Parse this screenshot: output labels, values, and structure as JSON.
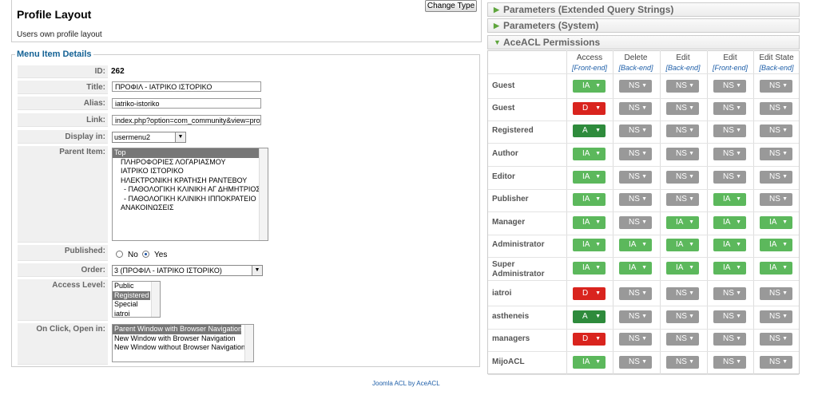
{
  "header": {
    "title": "Profile Layout",
    "description": "Users own profile layout",
    "change_type": "Change Type"
  },
  "details": {
    "legend": "Menu Item Details",
    "id_label": "ID:",
    "id_value": "262",
    "title_label": "Title:",
    "title_value": "ΠΡΟΦΙΛ - ΙΑΤΡΙΚΟ ΙΣΤΟΡΙΚΟ",
    "alias_label": "Alias:",
    "alias_value": "iatriko-istoriko",
    "link_label": "Link:",
    "link_value": "index.php?option=com_community&view=profi",
    "display_label": "Display in:",
    "display_value": "usermenu2",
    "parent_label": "Parent Item:",
    "parent_items": [
      "Top",
      "ΠΛΗΡΟΦΟΡΙΕΣ ΛΟΓΑΡΙΑΣΜΟΥ",
      "ΙΑΤΡΙΚΟ ΙΣΤΟΡΙΚΟ",
      "ΗΛΕΚΤΡΟΝΙΚΗ ΚΡΑΤΗΣΗ ΡΑΝΤΕΒΟΥ",
      "- ΠΑΘΟΛΟΓΙΚΗ ΚΛΙΝΙΚΗ ΑΓ ΔΗΜΗΤΡΙΟΣ",
      "- ΠΑΘΟΛΟΓΙΚΗ ΚΛΙΝΙΚΗ ΙΠΠΟΚΡΑΤΕΙΟ",
      "ΑΝΑΚΟΙΝΩΣΕΙΣ"
    ],
    "published_label": "Published:",
    "no_label": "No",
    "yes_label": "Yes",
    "order_label": "Order:",
    "order_value": "3 (ΠΡΟΦΙΛ - ΙΑΤΡΙΚΟ ΙΣΤΟΡΙΚΟ)",
    "access_label": "Access Level:",
    "access_items": [
      "Public",
      "Registered",
      "Special",
      "iatroi"
    ],
    "onclick_label": "On Click, Open in:",
    "onclick_items": [
      "Parent Window with Browser Navigation",
      "New Window with Browser Navigation",
      "New Window without Browser Navigation"
    ]
  },
  "footer": "Joomla ACL by AceACL",
  "panels": {
    "extended": "Parameters (Extended Query Strings)",
    "system": "Parameters (System)",
    "acl": "AceACL Permissions"
  },
  "acl": {
    "columns": [
      {
        "name": "Access",
        "sub": "[Front-end]"
      },
      {
        "name": "Delete",
        "sub": "[Back-end]"
      },
      {
        "name": "Edit",
        "sub": "[Back-end]"
      },
      {
        "name": "Edit",
        "sub": "[Front-end]"
      },
      {
        "name": "Edit State",
        "sub": "[Back-end]"
      }
    ],
    "rows": [
      {
        "group": "Guest",
        "values": [
          "IA",
          "NS",
          "NS",
          "NS",
          "NS"
        ]
      },
      {
        "group": "Guest",
        "values": [
          "D",
          "NS",
          "NS",
          "NS",
          "NS"
        ]
      },
      {
        "group": "Registered",
        "values": [
          "A",
          "NS",
          "NS",
          "NS",
          "NS"
        ]
      },
      {
        "group": "Author",
        "values": [
          "IA",
          "NS",
          "NS",
          "NS",
          "NS"
        ]
      },
      {
        "group": "Editor",
        "values": [
          "IA",
          "NS",
          "NS",
          "NS",
          "NS"
        ]
      },
      {
        "group": "Publisher",
        "values": [
          "IA",
          "NS",
          "NS",
          "IA",
          "NS"
        ]
      },
      {
        "group": "Manager",
        "values": [
          "IA",
          "NS",
          "IA",
          "IA",
          "IA"
        ]
      },
      {
        "group": "Administrator",
        "values": [
          "IA",
          "IA",
          "IA",
          "IA",
          "IA"
        ]
      },
      {
        "group": "Super Administrator",
        "values": [
          "IA",
          "IA",
          "IA",
          "IA",
          "IA"
        ]
      },
      {
        "group": "iatroi",
        "values": [
          "D",
          "NS",
          "NS",
          "NS",
          "NS"
        ]
      },
      {
        "group": "astheneis",
        "values": [
          "A",
          "NS",
          "NS",
          "NS",
          "NS"
        ]
      },
      {
        "group": "managers",
        "values": [
          "D",
          "NS",
          "NS",
          "NS",
          "NS"
        ]
      },
      {
        "group": "MijoACL",
        "values": [
          "IA",
          "NS",
          "NS",
          "NS",
          "NS"
        ]
      }
    ],
    "colors": {
      "IA": "#5cb85c",
      "NS": "#999999",
      "D": "#d9241e",
      "A": "#2e8b3c"
    }
  }
}
